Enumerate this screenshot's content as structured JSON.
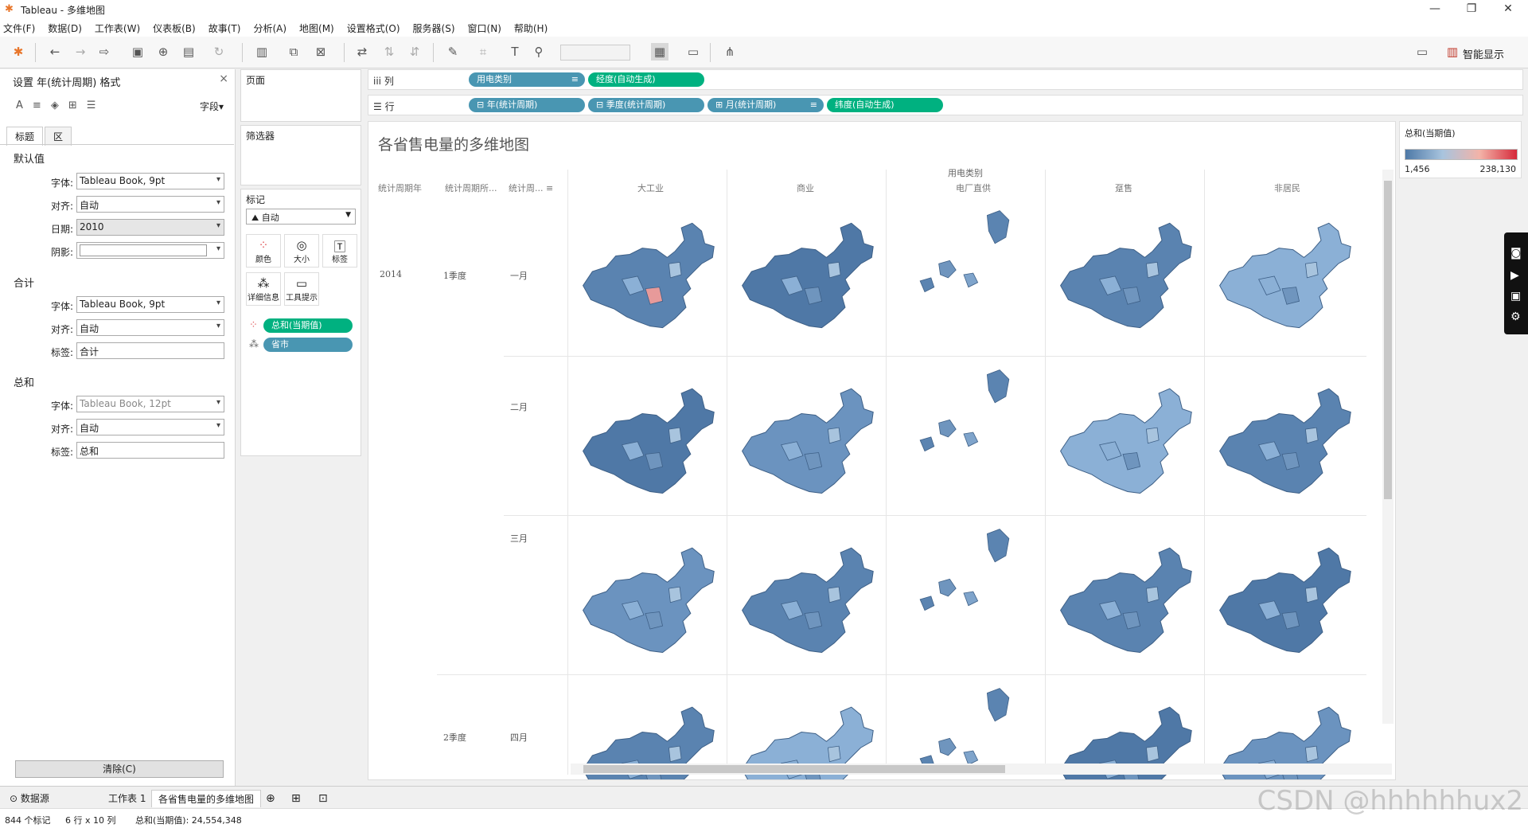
{
  "window": {
    "title": "Tableau - 多维地图",
    "min": "—",
    "max": "❐",
    "close": "✕"
  },
  "menu": [
    "文件(F)",
    "数据(D)",
    "工作表(W)",
    "仪表板(B)",
    "故事(T)",
    "分析(A)",
    "地图(M)",
    "设置格式(O)",
    "服务器(S)",
    "窗口(N)",
    "帮助(H)"
  ],
  "toolbar": {
    "smart_show": "智能显示"
  },
  "format_panel": {
    "title": "设置 年(统计周期) 格式",
    "field_btn": "字段▾",
    "tabs": [
      "标题",
      "区"
    ],
    "sections": [
      {
        "title": "默认值",
        "rows": [
          {
            "label": "字体:",
            "value": "Tableau Book, 9pt"
          },
          {
            "label": "对齐:",
            "value": "自动"
          },
          {
            "label": "日期:",
            "value": "2010"
          },
          {
            "label": "阴影:",
            "value": ""
          }
        ]
      },
      {
        "title": "合计",
        "rows": [
          {
            "label": "字体:",
            "value": "Tableau Book, 9pt"
          },
          {
            "label": "对齐:",
            "value": "自动"
          },
          {
            "label": "标签:",
            "value": "合计"
          }
        ]
      },
      {
        "title": "总和",
        "rows": [
          {
            "label": "字体:",
            "value": "Tableau Book, 12pt"
          },
          {
            "label": "对齐:",
            "value": "自动"
          },
          {
            "label": "标签:",
            "value": "总和"
          }
        ]
      }
    ],
    "clear_btn": "清除(C)"
  },
  "cards": {
    "pages": "页面",
    "filters": "筛选器",
    "marks": "标记",
    "mark_type": "自动",
    "mark_buttons": [
      "颜色",
      "大小",
      "标签",
      "详细信息",
      "工具提示"
    ],
    "mark_pills": [
      "总和(当期值)",
      "省市"
    ]
  },
  "shelves": {
    "columns_label": "列",
    "rows_label": "行",
    "columns": [
      {
        "text": "用电类别",
        "color": "blue"
      },
      {
        "text": "经度(自动生成)",
        "color": "green"
      }
    ],
    "rows": [
      {
        "text": "⊟ 年(统计周期)",
        "color": "blue"
      },
      {
        "text": "⊟ 季度(统计周期)",
        "color": "blue"
      },
      {
        "text": "⊞ 月(统计周期)",
        "color": "blue"
      },
      {
        "text": "纬度(自动生成)",
        "color": "green"
      }
    ]
  },
  "view": {
    "title": "各省售电量的多维地图",
    "group_header": "用电类别",
    "row_headers": [
      "统计周期年",
      "统计周期所...",
      "统计周..."
    ],
    "categories": [
      "大工业",
      "商业",
      "电厂直供",
      "趸售",
      "非居民"
    ],
    "year": "2014",
    "quarters": [
      {
        "label": "1季度",
        "row": 0
      },
      {
        "label": "2季度",
        "row": 3
      }
    ],
    "months": [
      "一月",
      "二月",
      "三月",
      "四月"
    ]
  },
  "legend": {
    "title": "总和(当期值)",
    "min": "1,456",
    "max": "238,130",
    "colors": [
      "#4e79a7",
      "#a8c4de",
      "#f3b3a8",
      "#d62a3b"
    ]
  },
  "sheet_tabs": {
    "datasource": "数据源",
    "sheet1": "工作表 1",
    "active": "各省售电量的多维地图"
  },
  "status": {
    "marks": "844 个标记",
    "dims": "6 行 x 10 列",
    "sum": "总和(当期值): 24,554,348"
  },
  "watermark": "CSDN @hhhhhhux2"
}
